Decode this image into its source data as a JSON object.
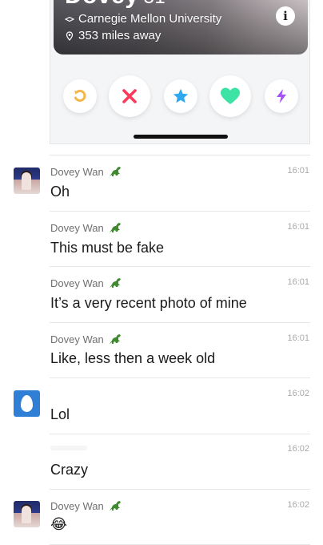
{
  "profile_card": {
    "name_partial": "Dovey",
    "age_partial": "31",
    "school": "Carnegie Mellon University",
    "distance": "353 miles away",
    "info_glyph": "i",
    "actions": [
      {
        "name": "rewind-button",
        "icon": "rewind-icon",
        "color": "#f5b748"
      },
      {
        "name": "nope-button",
        "icon": "close-icon",
        "color": "#fd3a5a"
      },
      {
        "name": "super-like-button",
        "icon": "star-icon",
        "color": "#2ea8ef"
      },
      {
        "name": "like-button",
        "icon": "heart-icon",
        "color": "#3de3a4"
      },
      {
        "name": "boost-button",
        "icon": "lightning-icon",
        "color": "#a552f7"
      }
    ]
  },
  "messages": [
    {
      "sender": "Dovey Wan",
      "time": "16:01",
      "text": "Oh"
    },
    {
      "sender": "Dovey Wan",
      "time": "16:01",
      "text": "This must be fake"
    },
    {
      "sender": "Dovey Wan",
      "time": "16:01",
      "text": "It’s a very recent photo of mine"
    },
    {
      "sender": "Dovey Wan",
      "time": "16:01",
      "text": "Like, less then a week old"
    },
    {
      "sender": "",
      "time": "16:02",
      "text": "Lol"
    },
    {
      "sender": "",
      "time": "16:02",
      "text": "Crazy"
    },
    {
      "sender": "Dovey Wan",
      "time": "16:02",
      "text": "😂"
    }
  ]
}
